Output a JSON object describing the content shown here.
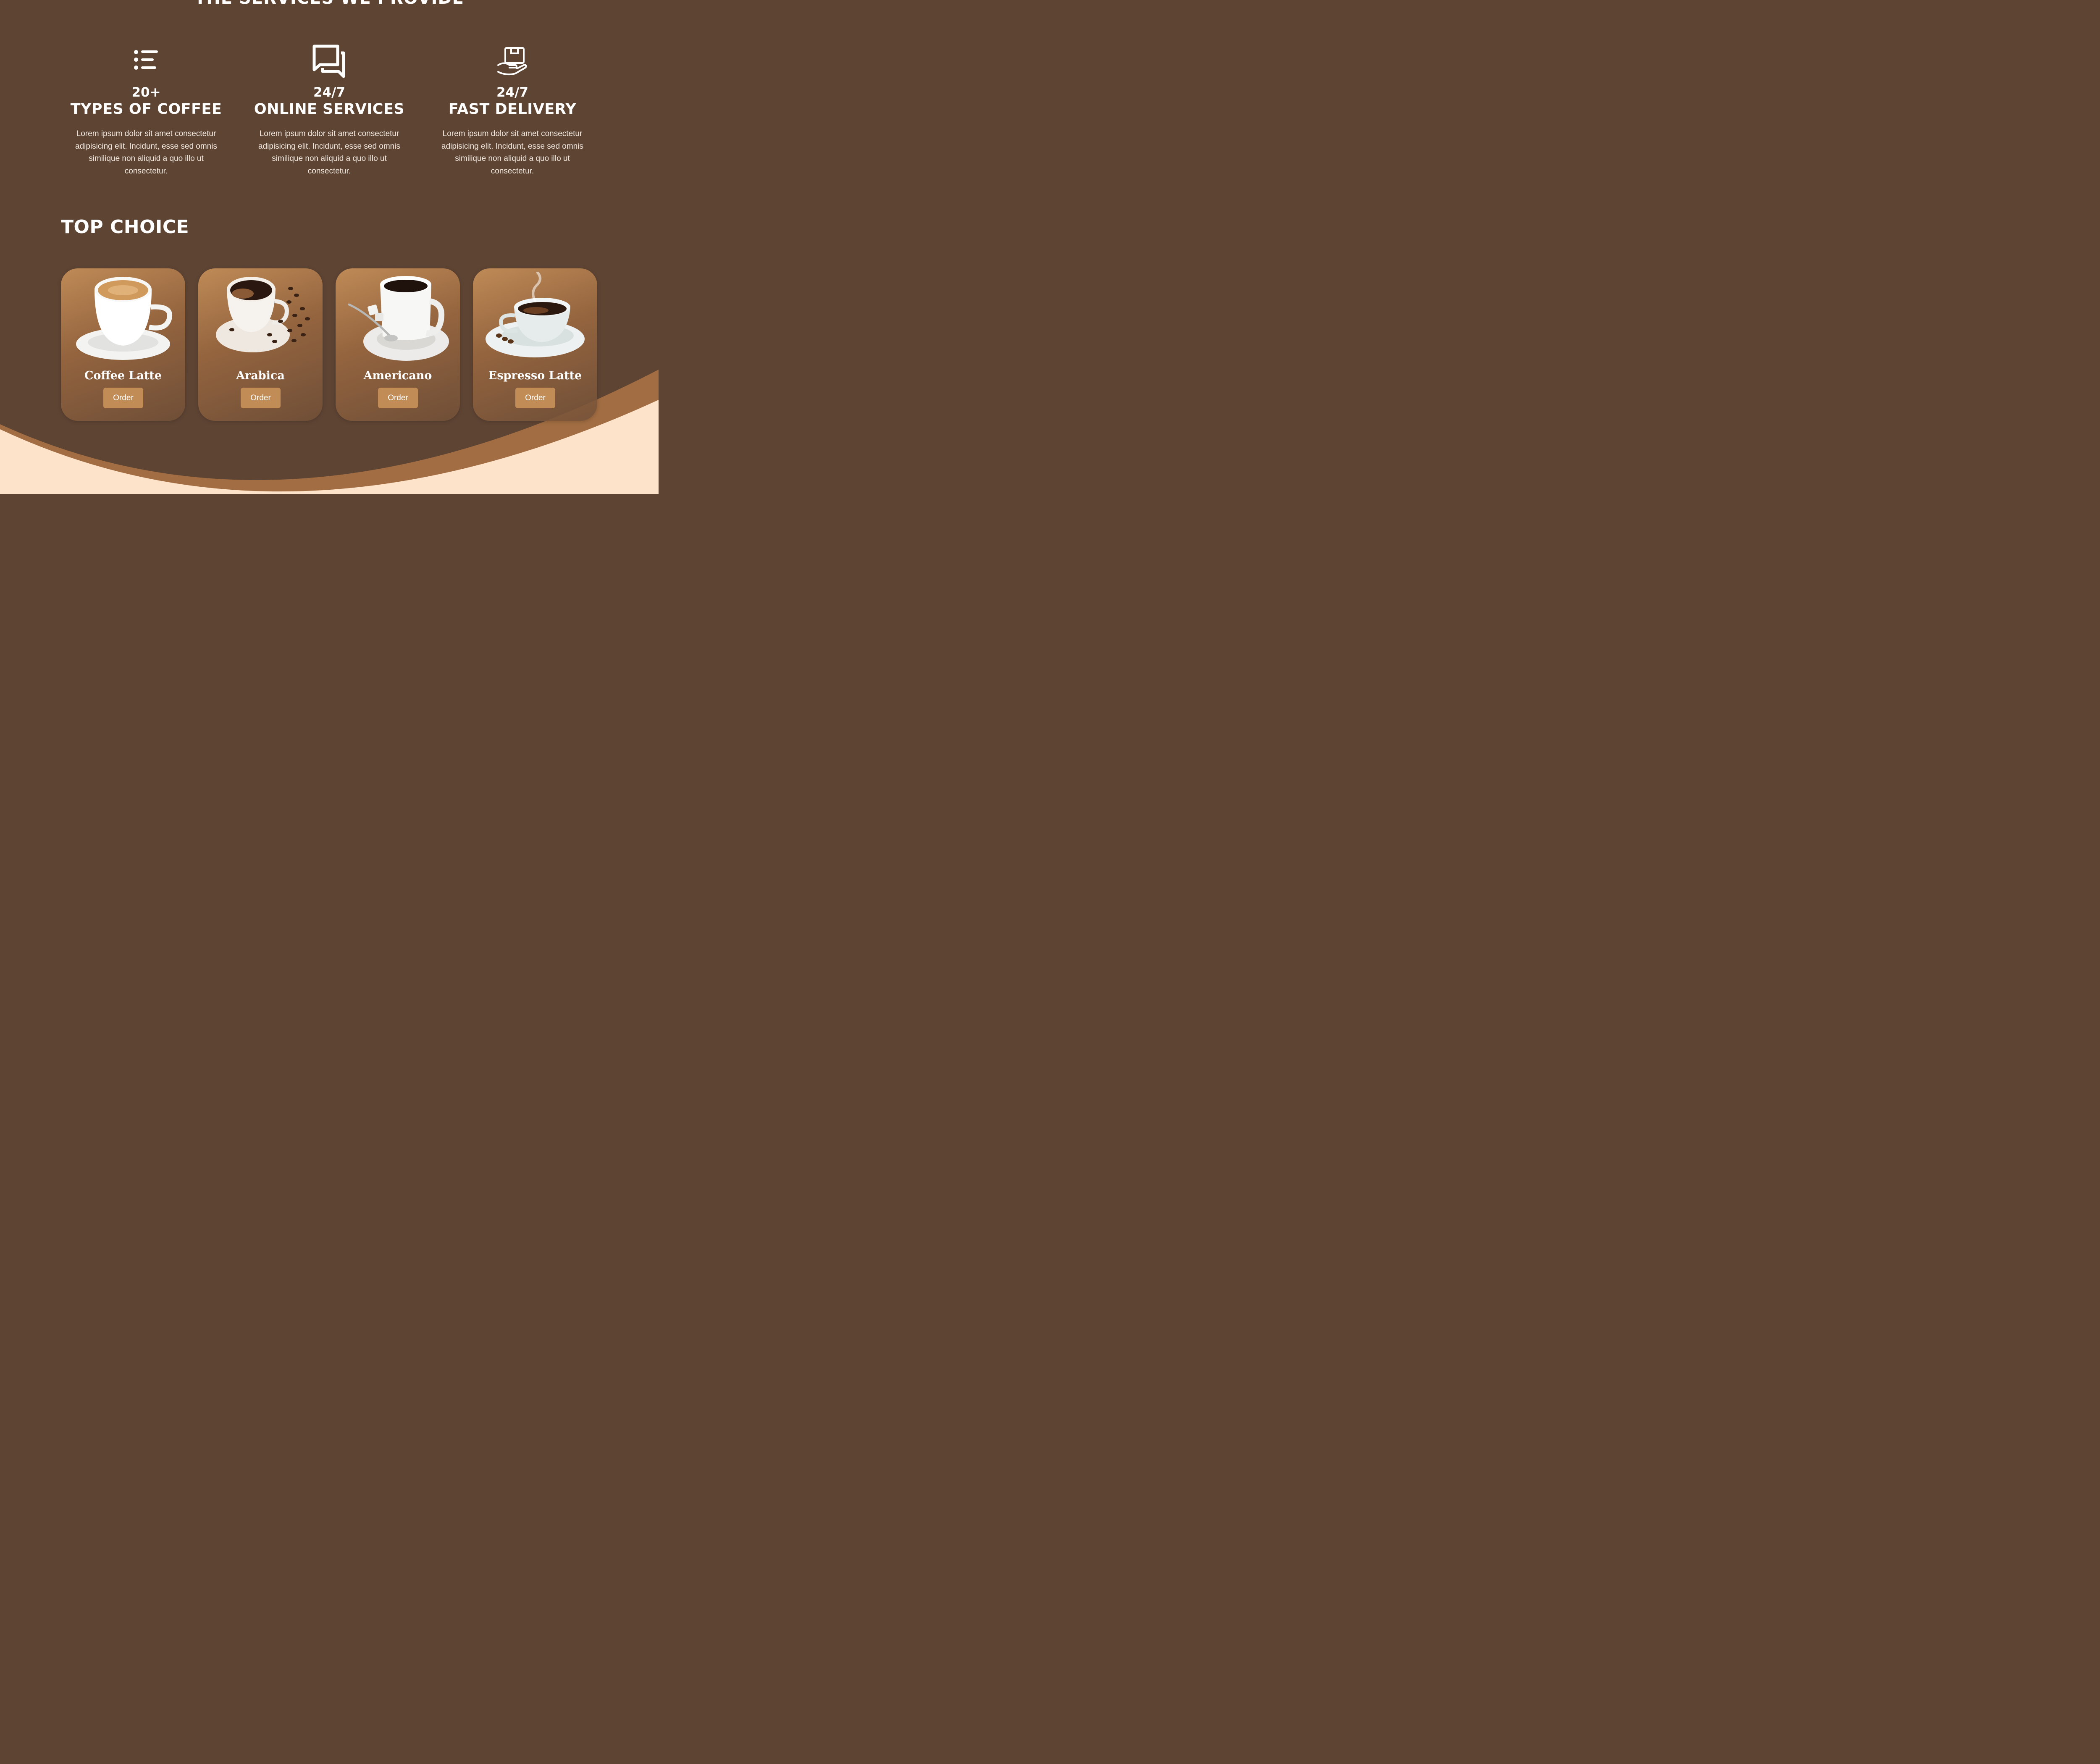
{
  "services_section": {
    "title": "THE SERVICES WE PROVIDE",
    "items": [
      {
        "number": "20+",
        "label": "TYPES OF COFFEE",
        "icon": "list-icon",
        "description": "Lorem ipsum dolor sit amet consectetur adipisicing elit. Incidunt, esse sed omnis similique non aliquid a quo illo ut consectetur."
      },
      {
        "number": "24/7",
        "label": "ONLINE SERVICES",
        "icon": "chat-icon",
        "description": "Lorem ipsum dolor sit amet consectetur adipisicing elit. Incidunt, esse sed omnis similique non aliquid a quo illo ut consectetur."
      },
      {
        "number": "24/7",
        "label": "FAST DELIVERY",
        "icon": "hand-box-icon",
        "description": "Lorem ipsum dolor sit amet consectetur adipisicing elit. Incidunt, esse sed omnis similique non aliquid a quo illo ut consectetur."
      }
    ]
  },
  "top_choice": {
    "title": "TOP CHOICE",
    "products": [
      {
        "name": "Coffee Latte",
        "order_label": "Order"
      },
      {
        "name": "Arabica",
        "order_label": "Order"
      },
      {
        "name": "Americano",
        "order_label": "Order"
      },
      {
        "name": "Espresso Latte",
        "order_label": "Order"
      }
    ]
  },
  "colors": {
    "background": "#5e4433",
    "accent": "#c28c57",
    "wave_band": "#a26d42",
    "wave_fill": "#fde3ca"
  }
}
